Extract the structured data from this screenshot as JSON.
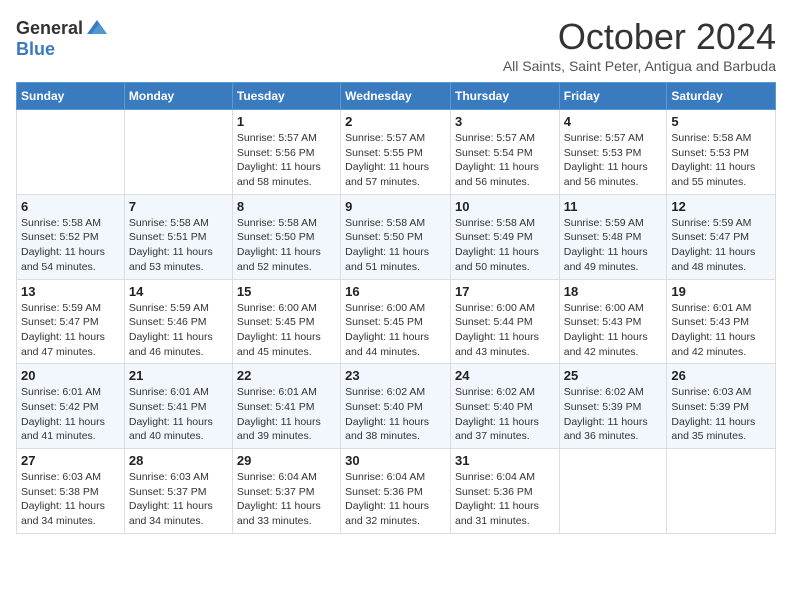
{
  "logo": {
    "general": "General",
    "blue": "Blue"
  },
  "title": "October 2024",
  "subtitle": "All Saints, Saint Peter, Antigua and Barbuda",
  "days_of_week": [
    "Sunday",
    "Monday",
    "Tuesday",
    "Wednesday",
    "Thursday",
    "Friday",
    "Saturday"
  ],
  "weeks": [
    [
      {
        "day": "",
        "info": ""
      },
      {
        "day": "",
        "info": ""
      },
      {
        "day": "1",
        "sunrise": "5:57 AM",
        "sunset": "5:56 PM",
        "daylight": "11 hours and 58 minutes."
      },
      {
        "day": "2",
        "sunrise": "5:57 AM",
        "sunset": "5:55 PM",
        "daylight": "11 hours and 57 minutes."
      },
      {
        "day": "3",
        "sunrise": "5:57 AM",
        "sunset": "5:54 PM",
        "daylight": "11 hours and 56 minutes."
      },
      {
        "day": "4",
        "sunrise": "5:57 AM",
        "sunset": "5:53 PM",
        "daylight": "11 hours and 56 minutes."
      },
      {
        "day": "5",
        "sunrise": "5:58 AM",
        "sunset": "5:53 PM",
        "daylight": "11 hours and 55 minutes."
      }
    ],
    [
      {
        "day": "6",
        "sunrise": "5:58 AM",
        "sunset": "5:52 PM",
        "daylight": "11 hours and 54 minutes."
      },
      {
        "day": "7",
        "sunrise": "5:58 AM",
        "sunset": "5:51 PM",
        "daylight": "11 hours and 53 minutes."
      },
      {
        "day": "8",
        "sunrise": "5:58 AM",
        "sunset": "5:50 PM",
        "daylight": "11 hours and 52 minutes."
      },
      {
        "day": "9",
        "sunrise": "5:58 AM",
        "sunset": "5:50 PM",
        "daylight": "11 hours and 51 minutes."
      },
      {
        "day": "10",
        "sunrise": "5:58 AM",
        "sunset": "5:49 PM",
        "daylight": "11 hours and 50 minutes."
      },
      {
        "day": "11",
        "sunrise": "5:59 AM",
        "sunset": "5:48 PM",
        "daylight": "11 hours and 49 minutes."
      },
      {
        "day": "12",
        "sunrise": "5:59 AM",
        "sunset": "5:47 PM",
        "daylight": "11 hours and 48 minutes."
      }
    ],
    [
      {
        "day": "13",
        "sunrise": "5:59 AM",
        "sunset": "5:47 PM",
        "daylight": "11 hours and 47 minutes."
      },
      {
        "day": "14",
        "sunrise": "5:59 AM",
        "sunset": "5:46 PM",
        "daylight": "11 hours and 46 minutes."
      },
      {
        "day": "15",
        "sunrise": "6:00 AM",
        "sunset": "5:45 PM",
        "daylight": "11 hours and 45 minutes."
      },
      {
        "day": "16",
        "sunrise": "6:00 AM",
        "sunset": "5:45 PM",
        "daylight": "11 hours and 44 minutes."
      },
      {
        "day": "17",
        "sunrise": "6:00 AM",
        "sunset": "5:44 PM",
        "daylight": "11 hours and 43 minutes."
      },
      {
        "day": "18",
        "sunrise": "6:00 AM",
        "sunset": "5:43 PM",
        "daylight": "11 hours and 42 minutes."
      },
      {
        "day": "19",
        "sunrise": "6:01 AM",
        "sunset": "5:43 PM",
        "daylight": "11 hours and 42 minutes."
      }
    ],
    [
      {
        "day": "20",
        "sunrise": "6:01 AM",
        "sunset": "5:42 PM",
        "daylight": "11 hours and 41 minutes."
      },
      {
        "day": "21",
        "sunrise": "6:01 AM",
        "sunset": "5:41 PM",
        "daylight": "11 hours and 40 minutes."
      },
      {
        "day": "22",
        "sunrise": "6:01 AM",
        "sunset": "5:41 PM",
        "daylight": "11 hours and 39 minutes."
      },
      {
        "day": "23",
        "sunrise": "6:02 AM",
        "sunset": "5:40 PM",
        "daylight": "11 hours and 38 minutes."
      },
      {
        "day": "24",
        "sunrise": "6:02 AM",
        "sunset": "5:40 PM",
        "daylight": "11 hours and 37 minutes."
      },
      {
        "day": "25",
        "sunrise": "6:02 AM",
        "sunset": "5:39 PM",
        "daylight": "11 hours and 36 minutes."
      },
      {
        "day": "26",
        "sunrise": "6:03 AM",
        "sunset": "5:39 PM",
        "daylight": "11 hours and 35 minutes."
      }
    ],
    [
      {
        "day": "27",
        "sunrise": "6:03 AM",
        "sunset": "5:38 PM",
        "daylight": "11 hours and 34 minutes."
      },
      {
        "day": "28",
        "sunrise": "6:03 AM",
        "sunset": "5:37 PM",
        "daylight": "11 hours and 34 minutes."
      },
      {
        "day": "29",
        "sunrise": "6:04 AM",
        "sunset": "5:37 PM",
        "daylight": "11 hours and 33 minutes."
      },
      {
        "day": "30",
        "sunrise": "6:04 AM",
        "sunset": "5:36 PM",
        "daylight": "11 hours and 32 minutes."
      },
      {
        "day": "31",
        "sunrise": "6:04 AM",
        "sunset": "5:36 PM",
        "daylight": "11 hours and 31 minutes."
      },
      {
        "day": "",
        "info": ""
      },
      {
        "day": "",
        "info": ""
      }
    ]
  ],
  "labels": {
    "sunrise": "Sunrise:",
    "sunset": "Sunset:",
    "daylight": "Daylight:"
  }
}
